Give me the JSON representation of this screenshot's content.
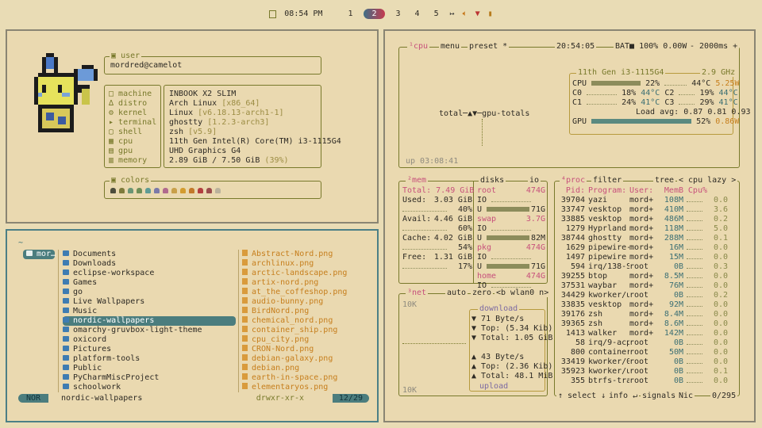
{
  "topbar": {
    "time": "08:54 PM",
    "workspaces": [
      "1",
      "2",
      "3",
      "4",
      "5"
    ],
    "active_ws": "2"
  },
  "fetch": {
    "user_title": "user",
    "user": "mordred@camelot",
    "labels": [
      "machine",
      "distro",
      "kernel",
      "terminal",
      "shell",
      "cpu",
      "gpu",
      "memory"
    ],
    "values": [
      [
        "INBOOK X2 SLIM",
        ""
      ],
      [
        "Arch Linux",
        "[x86_64]"
      ],
      [
        "Linux",
        "[v6.18.13-arch1-1]"
      ],
      [
        "ghostty",
        "[1.2.3-arch3]"
      ],
      [
        "zsh",
        "[v5.9]"
      ],
      [
        "11th Gen Intel(R) Core(TM) i3-1115G4",
        ""
      ],
      [
        "UHD Graphics G4",
        ""
      ],
      [
        "2.89 GiB / 7.50 GiB",
        "(39%)"
      ]
    ],
    "colors_title": "colors",
    "colors": [
      "#4d4d3c",
      "#7e7b3c",
      "#6b9575",
      "#6f8e58",
      "#5f9c95",
      "#7b7aa8",
      "#b06a8d",
      "#c8a04a",
      "#d39c2f",
      "#c2792a",
      "#b23f3f",
      "#9b4d4d",
      "#bab29c"
    ]
  },
  "yazi": {
    "breadcrumb": "~",
    "parent_item": "mor…",
    "dirs": [
      "Documents",
      "Downloads",
      "eclipse-workspace",
      "Games",
      "go",
      "Live Wallpapers",
      "Music",
      "nordic-wallpapers",
      "omarchy-gruvbox-light-theme",
      "oxicord",
      "Pictures",
      "platform-tools",
      "Public",
      "PyCharmMiscProject",
      "schoolwork"
    ],
    "files": [
      "Abstract-Nord.png",
      "archlinux.png",
      "arctic-landscape.png",
      "artix-nord.png",
      "at_the_coffeshop.png",
      "audio-bunny.png",
      "BirdNord.png",
      "chemical_nord.png",
      "container_ship.png",
      "cpu_city.png",
      "CRON-Nord.png",
      "debian-galaxy.png",
      "debian.png",
      "earth-in-space.png",
      "elementaryos.png"
    ],
    "status_mode": "NOR",
    "status_name": "nordic-wallpapers",
    "status_perm": "drwxr-xr-x",
    "status_pos": "12/29"
  },
  "btop": {
    "cpu_header": "¹cpu",
    "menu": "menu",
    "preset": "preset *",
    "clock": "20:54:05",
    "bat": "BAT■ 100% 0.00W",
    "interval": "- 2000ms +",
    "cpu_name": "11th Gen i3-1115G4",
    "cpu_freq": "2.9 GHz",
    "cpu_total": "22%",
    "cpu_temp": "44°C",
    "cpu_power": "5.25W",
    "cores": [
      [
        "C0",
        "18%",
        "44°C"
      ],
      [
        "C2",
        "19%",
        "44°C"
      ],
      [
        "C1",
        "24%",
        "41°C"
      ],
      [
        "C3",
        "29%",
        "41°C"
      ]
    ],
    "load_label": "Load avg:",
    "load": "0.87  0.81  0.93",
    "gpu_label": "GPU",
    "gpu_pct": "52%",
    "gpu_power": "0.86W",
    "graph_label": "total─▲▼─gpu-totals",
    "uptime": "up 03:08:41",
    "mem_header": "²mem",
    "mem_total": "Total: 7.49 GiB",
    "mem_rows": [
      [
        "Used:",
        "3.03 GiB",
        "40%"
      ],
      [
        "Avail:",
        "4.46 GiB",
        "60%"
      ],
      [
        "Cache:",
        "4.02 GiB",
        "54%"
      ],
      [
        "Free:",
        "1.31 GiB",
        "17%"
      ]
    ],
    "disks_header": "disks",
    "io_header": "io",
    "disks": [
      [
        "root",
        "474G",
        "71G"
      ],
      [
        "swap",
        "3.7G",
        "82M"
      ],
      [
        "pkg",
        "474G",
        "71G"
      ],
      [
        "home",
        "474G",
        ""
      ]
    ],
    "net_header": "³net",
    "net_auto": "auto",
    "net_zero": "zero",
    "net_iface": "<b wlan0 n>",
    "net_scale": "10K",
    "net_scale2": "10K",
    "download": "download",
    "dl": [
      "71 Byte/s",
      "Top: (5.34 Kib)",
      "Total: 1.05 GiB"
    ],
    "ul": [
      "43 Byte/s",
      "Top: (2.36 Kib)",
      "Total: 48.1 MiB"
    ],
    "upload": "upload",
    "proc_header": "⁴proc",
    "proc_filter": "filter",
    "proc_tree": "tree",
    "proc_sort": "< cpu lazy >",
    "proc_cols": [
      "Pid:",
      "Program:",
      "User:",
      "MemB",
      "Cpu%"
    ],
    "procs": [
      [
        "39704",
        "yazi",
        "mord+",
        "108M",
        "0.0"
      ],
      [
        "33747",
        "vesktop",
        "mord+",
        "410M",
        "3.6"
      ],
      [
        "33885",
        "vesktop",
        "mord+",
        "486M",
        "0.2"
      ],
      [
        "1279",
        "Hyprland",
        "mord+",
        "118M",
        "5.0"
      ],
      [
        "38744",
        "ghostty",
        "mord+",
        "288M",
        "0.1"
      ],
      [
        "1629",
        "pipewire-",
        "mord+",
        "16M",
        "0.0"
      ],
      [
        "1497",
        "pipewire",
        "mord+",
        "15M",
        "0.0"
      ],
      [
        "594",
        "irq/138-S",
        "root",
        "0B",
        "0.3"
      ],
      [
        "39255",
        "btop",
        "mord+",
        "8.5M",
        "0.0"
      ],
      [
        "37531",
        "waybar",
        "mord+",
        "76M",
        "0.0"
      ],
      [
        "34429",
        "kworker/u",
        "root",
        "0B",
        "0.2"
      ],
      [
        "33835",
        "vesktop",
        "mord+",
        "92M",
        "0.0"
      ],
      [
        "39176",
        "zsh",
        "mord+",
        "8.4M",
        "0.0"
      ],
      [
        "39365",
        "zsh",
        "mord+",
        "8.6M",
        "0.0"
      ],
      [
        "1413",
        "walker",
        "mord+",
        "142M",
        "0.0"
      ],
      [
        "58",
        "irq/9-acp",
        "root",
        "0B",
        "0.0"
      ],
      [
        "800",
        "container",
        "root",
        "50M",
        "0.0"
      ],
      [
        "33419",
        "kworker/0",
        "root",
        "0B",
        "0.0"
      ],
      [
        "35923",
        "kworker/u",
        "root",
        "0B",
        "0.1"
      ],
      [
        "355",
        "btrfs-tra",
        "root",
        "0B",
        "0.0"
      ]
    ],
    "proc_footer_left": "↑ select ↓",
    "proc_footer_info": "info ↵",
    "proc_footer_signals": "signals",
    "proc_footer_nice": "Nic",
    "proc_count": "0/295"
  }
}
